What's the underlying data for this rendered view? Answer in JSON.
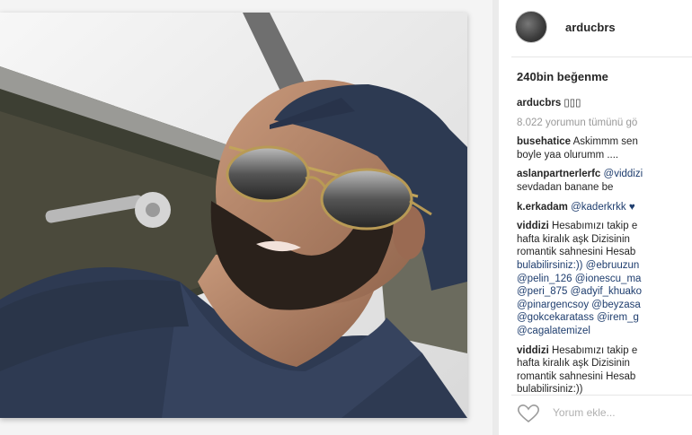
{
  "post": {
    "username": "arducbrs",
    "likes": "240bin beğenme",
    "caption_user": "arducbrs",
    "caption_text": "▯▯▯",
    "view_all_comments": "8.022 yorumun tümünü gö"
  },
  "comments": [
    {
      "user": "busehatice",
      "lines": [
        "Askimmm sen",
        "boyle yaa olurumm ...."
      ]
    },
    {
      "user": "aslanpartnerlerfc",
      "lines": [
        "@viddizi",
        "sevdadan banane be"
      ]
    },
    {
      "user": "k.erkadam",
      "lines": [
        "@kaderkrkk ♥"
      ]
    },
    {
      "user": "viddizi",
      "lines": [
        "Hesabımızı takip e",
        "hafta kiralık aşk Dizisinin",
        "romantik sahnesini Hesab",
        "bulabilirsiniz:)) @ebruuzun",
        "@pelin_126 @ionescu_ma",
        "@peri_875 @adyif_khuako",
        "@pinargencsoy @beyzasa",
        "@gokcekaratass @irem_g",
        "@cagalatemizel"
      ]
    },
    {
      "user": "viddizi",
      "lines": [
        "Hesabımızı takip e",
        "hafta kiralık aşk Dizisinin",
        "romantik sahnesini Hesab",
        "bulabilirsiniz:))"
      ]
    }
  ],
  "add_comment_placeholder": "Yorum ekle...",
  "icons": {
    "like": "heart-outline-icon"
  },
  "colors": {
    "mention": "#1e3d6e",
    "muted": "#999999"
  }
}
